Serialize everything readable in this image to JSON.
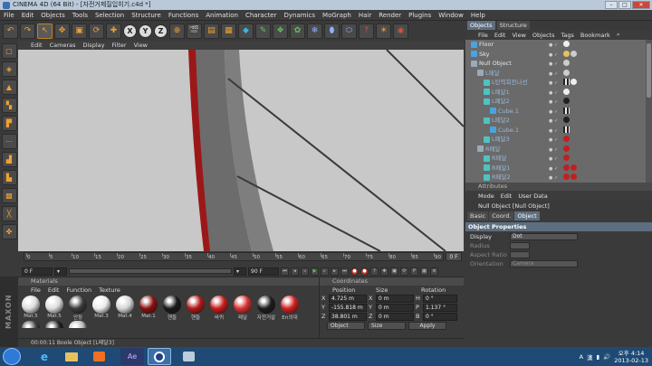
{
  "window": {
    "title": "CINEMA 4D (64 Bit) - [자전거제질입히기.c4d *]"
  },
  "menubar": [
    "File",
    "Edit",
    "Objects",
    "Tools",
    "Selection",
    "Structure",
    "Functions",
    "Animation",
    "Character",
    "Dynamics",
    "MoGraph",
    "Hair",
    "Render",
    "Plugins",
    "Window",
    "Help"
  ],
  "toolbar": {
    "axis_x": "X",
    "axis_y": "Y",
    "axis_z": "Z"
  },
  "viewport": {
    "menu": [
      "Edit",
      "Cameras",
      "Display",
      "Filter",
      "View"
    ]
  },
  "timeline": {
    "ticks": [
      "0",
      "5",
      "10",
      "15",
      "20",
      "25",
      "30",
      "35",
      "40",
      "45",
      "50",
      "55",
      "60",
      "65",
      "70",
      "75",
      "80",
      "85",
      "90"
    ],
    "end_label": "0 F",
    "start_field": "0 F",
    "current_field": "0 F",
    "end_field": "90 F"
  },
  "materials": {
    "header": "Materials",
    "menu": [
      "File",
      "Edit",
      "Function",
      "Texture"
    ],
    "items": [
      {
        "label": "Mat.5",
        "color": "#dcdcdc"
      },
      {
        "label": "Mat.5",
        "color": "#dcdcdc"
      },
      {
        "label": "안장",
        "color": "#3a3a3a"
      },
      {
        "label": "Mat.3",
        "color": "#ececec"
      },
      {
        "label": "Mat.4",
        "color": "#d6d6d6"
      },
      {
        "label": "Mat.1",
        "color": "#8a1010"
      },
      {
        "label": "핸들",
        "color": "#1a1a1a"
      },
      {
        "label": "핸들",
        "color": "#b01818"
      },
      {
        "label": "바퀴",
        "color": "#c81c1c"
      },
      {
        "label": "페달",
        "color": "#d83030"
      },
      {
        "label": "자전거살",
        "color": "#1c1c1c"
      },
      {
        "label": "Eri의대",
        "color": "#d02020"
      }
    ]
  },
  "coordinates": {
    "header": "Coordinates",
    "columns": [
      "Position",
      "Size",
      "Rotation"
    ],
    "rows": [
      {
        "axis": "X",
        "pos": "4.725 m",
        "size": "0 m",
        "rot_axis": "H",
        "rot": "0 °"
      },
      {
        "axis": "Y",
        "pos": "-155.818 m",
        "size": "0 m",
        "rot_axis": "P",
        "rot": "1.137 °"
      },
      {
        "axis": "Z",
        "pos": "38.801 m",
        "size": "0 m",
        "rot_axis": "B",
        "rot": "0 °"
      }
    ],
    "mode_select": "Object",
    "size_select": "Size",
    "apply": "Apply"
  },
  "status": {
    "text": "00:00:11  Boole Object [L페달3]"
  },
  "objects": {
    "tabs": [
      "Objects",
      "Structure"
    ],
    "menu": [
      "File",
      "Edit",
      "View",
      "Objects",
      "Tags",
      "Bookmark"
    ],
    "rows": [
      {
        "name": "Floor",
        "indent": 0
      },
      {
        "name": "Sky",
        "indent": 0
      },
      {
        "name": "Null Object",
        "indent": 0
      },
      {
        "name": "L페달",
        "indent": 1
      },
      {
        "name": "L탄력회전나선",
        "indent": 2
      },
      {
        "name": "L페달1",
        "indent": 2
      },
      {
        "name": "L페달2",
        "indent": 2
      },
      {
        "name": "Cube.1",
        "indent": 3
      },
      {
        "name": "L페달2",
        "indent": 2
      },
      {
        "name": "Cube.1",
        "indent": 3
      },
      {
        "name": "L페달3",
        "indent": 2
      },
      {
        "name": "R페달",
        "indent": 1
      },
      {
        "name": "R페달",
        "indent": 2
      },
      {
        "name": "R페달1",
        "indent": 2
      },
      {
        "name": "R페달2",
        "indent": 2
      }
    ]
  },
  "attributes": {
    "header": "Attributes",
    "menu": [
      "Mode",
      "Edit",
      "User Data"
    ],
    "object_title": "Null Object [Null Object]",
    "tabs": [
      "Basic",
      "Coord.",
      "Object"
    ],
    "section": "Object Properties",
    "display_label": "Display",
    "display_value": "Dot",
    "radius_label": "Radius",
    "aspect_label": "Aspect Ratio",
    "orientation_label": "Orientation",
    "orientation_value": "Camera"
  },
  "taskbar": {
    "time": "오후 4:14",
    "date": "2013-02-13",
    "lang": "A",
    "ime": "漢"
  },
  "colors": {
    "accent_orange": "#f0a030",
    "selection_blue": "#5e6e80",
    "taskbar": "#1e4a75"
  }
}
